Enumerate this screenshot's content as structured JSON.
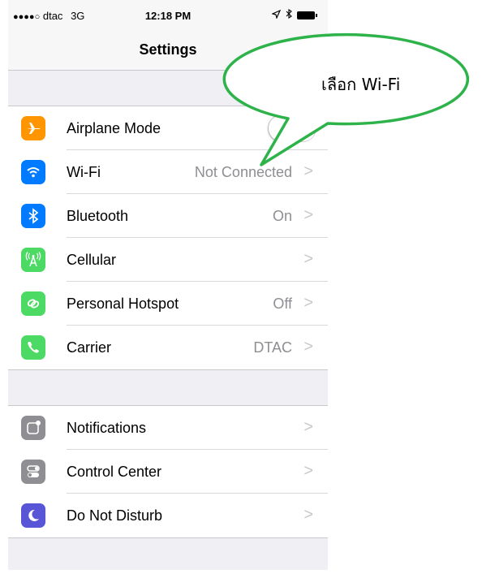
{
  "status": {
    "dots": "●●●●○",
    "carrier": "dtac",
    "network": "3G",
    "time": "12:18 PM"
  },
  "nav": {
    "title": "Settings"
  },
  "groups": [
    {
      "items": [
        {
          "label": "Airplane Mode",
          "value": "",
          "icon": "airplane-icon",
          "color": "#ff9500",
          "control": "toggle",
          "toggle_on": false
        },
        {
          "label": "Wi-Fi",
          "value": "Not Connected",
          "icon": "wifi-icon",
          "color": "#007aff",
          "control": "chevron"
        },
        {
          "label": "Bluetooth",
          "value": "On",
          "icon": "bluetooth-icon",
          "color": "#007aff",
          "control": "chevron"
        },
        {
          "label": "Cellular",
          "value": "",
          "icon": "cellular-icon",
          "color": "#4cd964",
          "control": "chevron"
        },
        {
          "label": "Personal Hotspot",
          "value": "Off",
          "icon": "hotspot-icon",
          "color": "#4cd964",
          "control": "chevron"
        },
        {
          "label": "Carrier",
          "value": "DTAC",
          "icon": "phone-icon",
          "color": "#4cd964",
          "control": "chevron"
        }
      ]
    },
    {
      "items": [
        {
          "label": "Notifications",
          "value": "",
          "icon": "notifications-icon",
          "color": "#8e8e93",
          "control": "chevron"
        },
        {
          "label": "Control Center",
          "value": "",
          "icon": "control-center-icon",
          "color": "#8e8e93",
          "control": "chevron"
        },
        {
          "label": "Do Not Disturb",
          "value": "",
          "icon": "moon-icon",
          "color": "#5856d6",
          "control": "chevron"
        }
      ]
    }
  ],
  "callout": {
    "text": "เลือก Wi-Fi",
    "border_color": "#2db34a"
  }
}
